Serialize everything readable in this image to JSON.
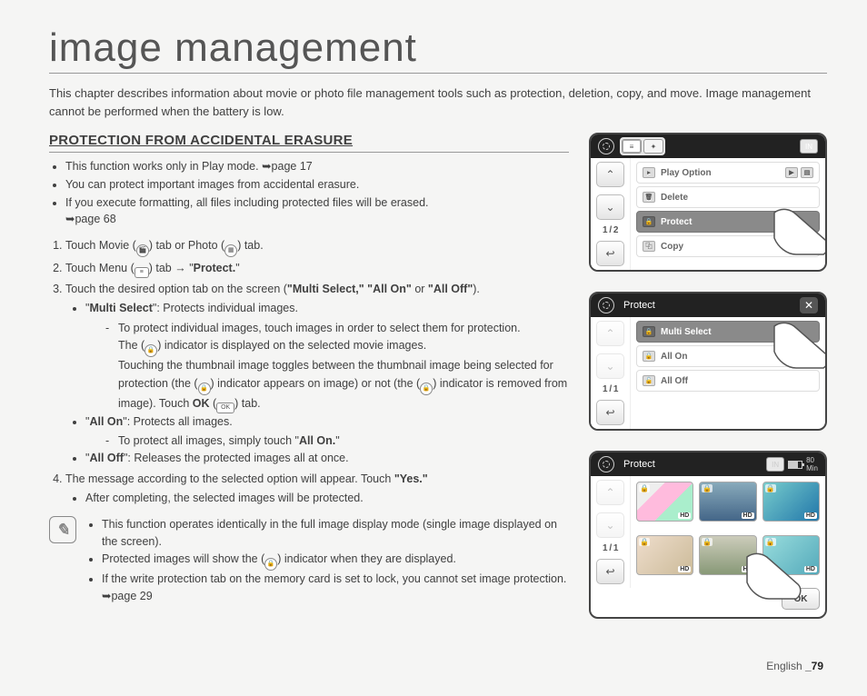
{
  "title": "image management",
  "intro": "This chapter describes information about movie or photo file management tools such as protection, deletion, copy, and move. Image management cannot be performed when the battery is low.",
  "section_heading": "PROTECTION FROM ACCIDENTAL ERASURE",
  "bullets": {
    "b1": "This function works only in Play mode. ➥page 17",
    "b2": "You can protect important images from accidental erasure.",
    "b3a": "If you execute formatting, all files including protected files will be erased.",
    "b3b": "➥page 68"
  },
  "steps": {
    "s1_a": "Touch Movie (",
    "s1_b": ") tab or Photo (",
    "s1_c": ") tab.",
    "s2_a": "Touch Menu (",
    "s2_b": ") tab ",
    "s2_c": "→",
    "s2_d": " \"",
    "s2_e": "Protect.",
    "s2_f": "\"",
    "s3_a": "Touch the desired option tab on the screen (",
    "s3_b": "\"Multi Select,\" \"All On\"",
    "s3_c": " or ",
    "s3_d": "\"All Off\"",
    "s3_e": ").",
    "ms_label": "Multi Select",
    "ms_desc": ": Protects individual images.",
    "ms_d1a": "To protect individual images, touch images in order to select them for protection.",
    "ms_d1b_a": "The (",
    "ms_d1b_b": ") indicator is displayed on the selected movie images.",
    "ms_d1c_a": "Touching the thumbnail image toggles between the thumbnail image being selected for protection (the (",
    "ms_d1c_b": ") indicator appears on image) or not (the (",
    "ms_d1c_c": ") indicator is removed from image). Touch ",
    "ms_d1c_ok": "OK",
    "ms_d1c_d": " (",
    "ms_d1c_e": ") tab.",
    "ao_label": "All On",
    "ao_desc": ": Protects all images.",
    "ao_d1_a": "To protect all images, simply touch \"",
    "ao_d1_b": "All On.",
    "ao_d1_c": "\"",
    "af_label": "All Off",
    "af_desc": ": Releases the protected images all at once.",
    "s4_a": "The message according to the selected option will appear. Touch ",
    "s4_b": "\"Yes.\"",
    "s4_sub": "After completing, the selected images will be protected."
  },
  "notes": {
    "n1": "This function operates identically in the full image display mode (single image displayed on the screen).",
    "n2_a": "Protected images will show the (",
    "n2_b": ") indicator when they are displayed.",
    "n3": "If the write protection tab on the memory card is set to lock, you cannot set image protection. ➥page 29"
  },
  "panel1": {
    "page": "1 / 2",
    "items": {
      "play_option": "Play Option",
      "delete": "Delete",
      "protect": "Protect",
      "copy": "Copy"
    }
  },
  "panel2": {
    "title": "Protect",
    "page": "1 / 1",
    "items": {
      "multi_select": "Multi Select",
      "all_on": "All On",
      "all_off": "All Off"
    }
  },
  "panel3": {
    "title": "Protect",
    "page": "1 / 1",
    "ok": "OK",
    "time": "80",
    "time_unit": "Min",
    "hd": "HD"
  },
  "footer": {
    "lang": "English ",
    "page": "_79"
  },
  "storage_label": "IN"
}
